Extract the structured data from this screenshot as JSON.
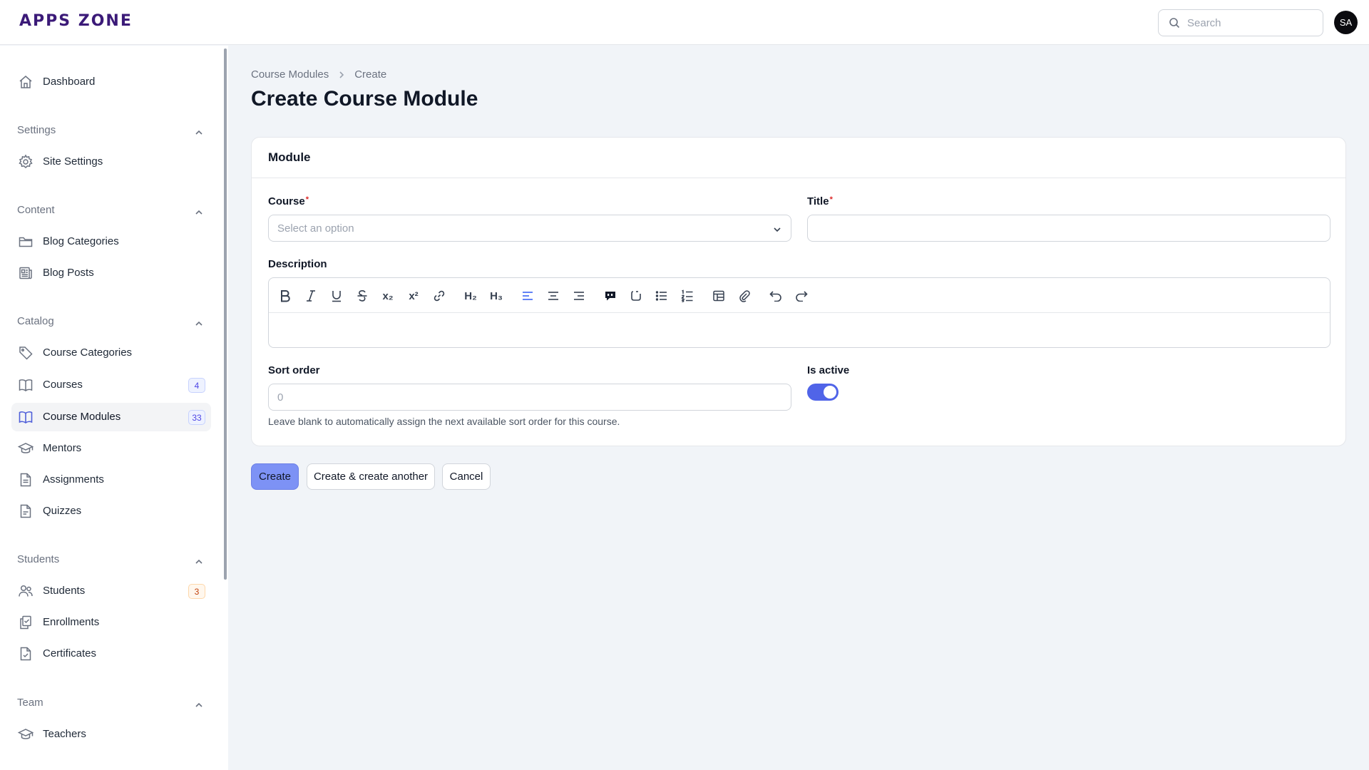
{
  "app": {
    "logo": "APPS ZONE",
    "avatar_initials": "SA",
    "search_placeholder": "Search"
  },
  "sidebar": {
    "dashboard": "Dashboard",
    "groups": {
      "settings": "Settings",
      "content": "Content",
      "catalog": "Catalog",
      "students": "Students",
      "team": "Team"
    },
    "items": {
      "site_settings": "Site Settings",
      "blog_categories": "Blog Categories",
      "blog_posts": "Blog Posts",
      "course_categories": "Course Categories",
      "courses": "Courses",
      "courses_badge": "4",
      "course_modules": "Course Modules",
      "course_modules_badge": "33",
      "mentors": "Mentors",
      "assignments": "Assignments",
      "quizzes": "Quizzes",
      "students": "Students",
      "students_badge": "3",
      "enrollments": "Enrollments",
      "certificates": "Certificates",
      "teachers": "Teachers"
    }
  },
  "breadcrumb": {
    "parent": "Course Modules",
    "current": "Create"
  },
  "page": {
    "title": "Create Course Module"
  },
  "form": {
    "section_title": "Module",
    "course_label": "Course",
    "course_placeholder": "Select an option",
    "title_label": "Title",
    "required_mark": "*",
    "description_label": "Description",
    "toolbar": {
      "h2": "H₂",
      "h3": "H₃",
      "sub": "x₂",
      "sup": "x²"
    },
    "sort_order_label": "Sort order",
    "sort_order_placeholder": "0",
    "sort_order_hint": "Leave blank to automatically assign the next available sort order for this course.",
    "is_active_label": "Is active",
    "is_active": true
  },
  "actions": {
    "create": "Create",
    "create_another": "Create & create another",
    "cancel": "Cancel"
  },
  "colors": {
    "accent": "#5064e8",
    "primary_button": "#7d92f5",
    "brand": "#3b1a78"
  }
}
